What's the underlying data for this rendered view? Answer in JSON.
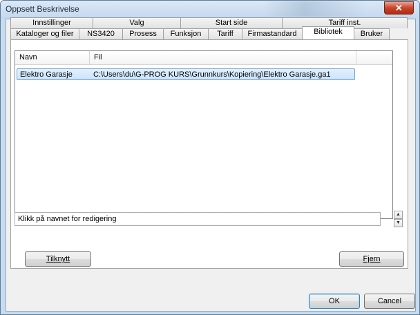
{
  "window": {
    "title": "Oppsett Beskrivelse",
    "close_glyph": "✕"
  },
  "tabs_row1": [
    "Innstillinger",
    "Valg",
    "Start side",
    "Tariff inst."
  ],
  "tabs_row2": [
    "Kataloger og filer",
    "NS3420",
    "Prosess",
    "Funksjon",
    "Tariff",
    "Firmastandard",
    "Bibliotek",
    "Bruker"
  ],
  "active_tab": "Bibliotek",
  "list": {
    "columns": [
      "Navn",
      "Fil"
    ],
    "rows": [
      {
        "navn": "Elektro Garasje",
        "fil": "C:\\Users\\du\\G-PROG KURS\\Grunnkurs\\Kopiering\\Elektro Garasje.ga1"
      }
    ]
  },
  "hint": "Klikk på navnet for redigering",
  "buttons": {
    "attach": "Tilknytt",
    "remove": "Fjern",
    "ok": "OK",
    "cancel": "Cancel"
  },
  "icons": {
    "spin_up": "▲",
    "spin_down": "▼"
  }
}
